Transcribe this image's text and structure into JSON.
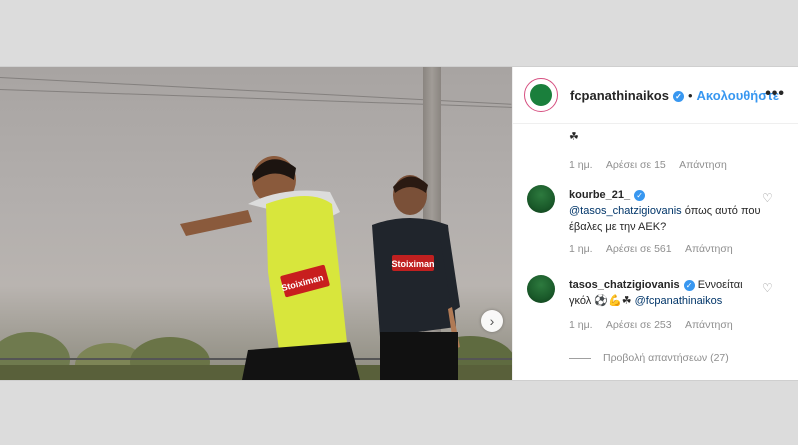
{
  "post": {
    "username": "fcpanathinaikos",
    "follow_label": "Ακολουθήστε",
    "more_label": "•••",
    "sponsor_text": "Stoiximan"
  },
  "comments": {
    "first": {
      "text": "☘",
      "time": "1 ημ.",
      "likes": "Αρέσει σε 15",
      "reply": "Απάντηση"
    },
    "items": [
      {
        "user": "kourbe_21_",
        "mention": "@tasos_chatzigiovanis",
        "text": " όπως αυτό που έβαλες με την ΑΕΚ?",
        "time": "1 ημ.",
        "likes": "Αρέσει σε 561",
        "reply": "Απάντηση"
      },
      {
        "user": "tasos_chatzigiovanis",
        "text": " Εννοείται γκόλ ⚽💪☘ ",
        "mention": "@fcpanathinaikos",
        "time": "1 ημ.",
        "likes": "Αρέσει σε 253",
        "reply": "Απάντηση"
      }
    ],
    "view_replies": "Προβολή απαντήσεων (27)"
  },
  "colors": {
    "link": "#3897f0",
    "verified": "#3897f0",
    "muted": "#8e8e8e"
  }
}
